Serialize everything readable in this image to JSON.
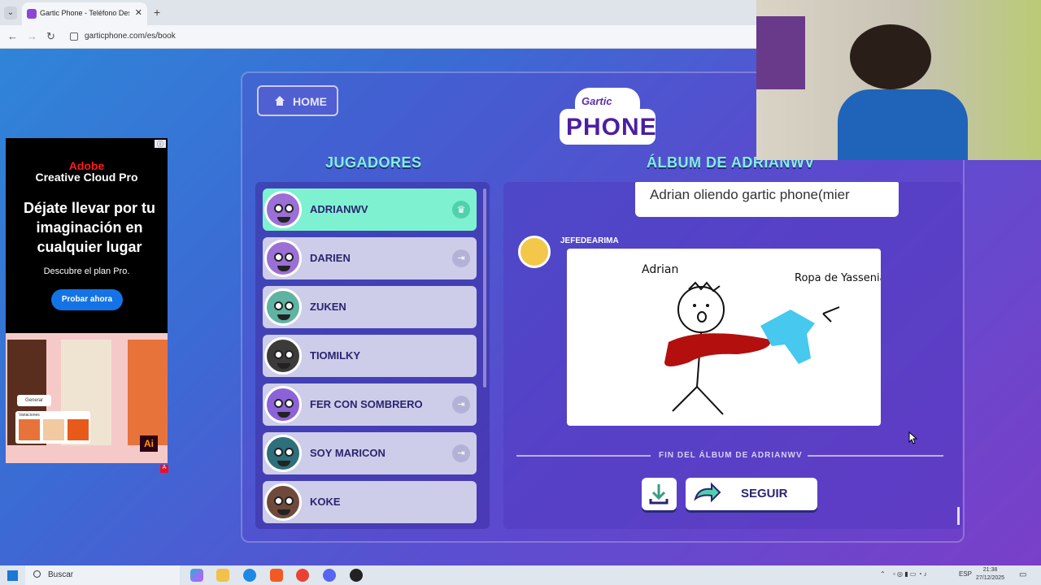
{
  "browser": {
    "tab_title": "Gartic Phone - Teléfono Descon",
    "new_tab": "+",
    "url": "garticphone.com/es/book"
  },
  "header": {
    "home_label": "HOME",
    "logo_top": "Gartic",
    "logo_main": "PHONE"
  },
  "players": {
    "heading": "JUGADORES",
    "items": [
      {
        "name": "ADRIANWV",
        "status": "host"
      },
      {
        "name": "DARIEN",
        "status": "exit"
      },
      {
        "name": "ZUKEN",
        "status": ""
      },
      {
        "name": "TIOMILKY",
        "status": ""
      },
      {
        "name": "FER CON SOMBRERO",
        "status": "exit"
      },
      {
        "name": "SOY MARICON",
        "status": "exit"
      },
      {
        "name": "KOKE",
        "status": ""
      }
    ]
  },
  "album": {
    "heading": "ÁLBUM DE ADRIANWV",
    "caption": "Adrian oliendo gartic phone(mier",
    "author": "JEFEDEARIMA",
    "drawing_text_1": "Adrian",
    "drawing_text_2": "Ropa de Yassenia",
    "end_label": "FIN DEL ÁLBUM DE ADRIANWV",
    "continue_label": "SEGUIR"
  },
  "ad": {
    "brand": "Adobe",
    "product": "Creative Cloud Pro",
    "headline": "Déjate llevar por tu imaginación en cualquier lugar",
    "subline": "Descubre el plan Pro.",
    "cta": "Probar ahora",
    "generate": "Generar",
    "variations": "Variaciones"
  },
  "taskbar": {
    "search": "Buscar",
    "lang": "ESP",
    "time": "21:38",
    "date": "27/12/2025"
  },
  "colors": {
    "accent_teal": "#7ef2d0",
    "player_bg": "#cdcde9",
    "heading": "#7ff0e0",
    "brand_purple": "#4b1fa0"
  }
}
